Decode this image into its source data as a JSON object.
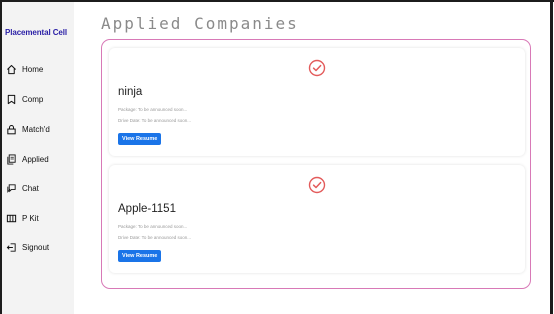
{
  "sidebar": {
    "brand": "Placemental Cell",
    "items": [
      {
        "label": "Home",
        "icon": "home-icon"
      },
      {
        "label": "Comp",
        "icon": "bookmark-icon"
      },
      {
        "label": "Match'd",
        "icon": "lock-icon"
      },
      {
        "label": "Applied",
        "icon": "documents-icon"
      },
      {
        "label": "Chat",
        "icon": "chat-icon"
      },
      {
        "label": "P Kit",
        "icon": "kit-icon"
      },
      {
        "label": "Signout",
        "icon": "signout-icon"
      }
    ]
  },
  "main": {
    "title": "Applied Companies",
    "cards": [
      {
        "company": "ninja",
        "package": "Package: To be announced soon...",
        "drive_date": "Drive Date: To be announced soon...",
        "button": "View Resume"
      },
      {
        "company": "Apple-1151",
        "package": "Package: To be announced soon...",
        "drive_date": "Drive Date: To be announced soon...",
        "button": "View Resume"
      }
    ]
  },
  "colors": {
    "brand": "#2a1fa6",
    "accent_border": "#d879b7",
    "check_icon": "#e35b5b",
    "button": "#1a74e8",
    "sidebar_bg": "#f3f3f3"
  }
}
